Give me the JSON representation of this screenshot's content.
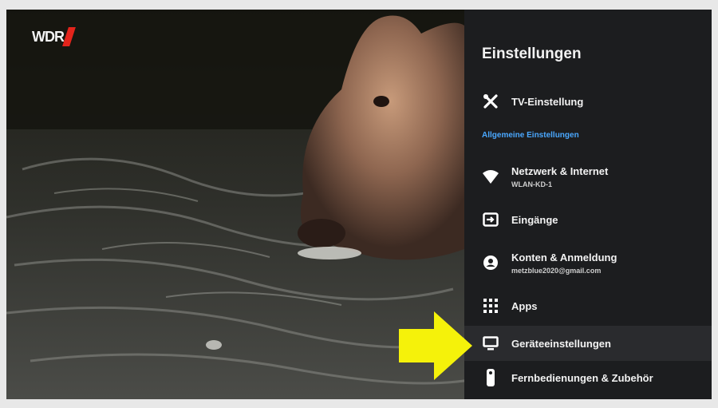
{
  "channel": {
    "logo_text": "WDR"
  },
  "settings": {
    "title": "Einstellungen",
    "section_header": "Allgemeine Einstellungen",
    "items": [
      {
        "label": "TV-Einstellung",
        "icon": "tools-icon"
      },
      {
        "label": "Netzwerk & Internet",
        "sub": "WLAN-KD-1",
        "icon": "wifi-icon"
      },
      {
        "label": "Eingänge",
        "icon": "input-icon"
      },
      {
        "label": "Konten & Anmeldung",
        "sub": "metzblue2020@gmail.com",
        "icon": "account-icon"
      },
      {
        "label": "Apps",
        "icon": "apps-grid-icon"
      },
      {
        "label": "Geräteeinstellungen",
        "icon": "tv-icon",
        "selected": true
      },
      {
        "label": "Fernbedienungen & Zubehör",
        "icon": "remote-icon"
      }
    ]
  },
  "colors": {
    "accent": "#4aa8ff",
    "arrow": "#f5f20a",
    "panel_bg": "#1c1d1f"
  }
}
